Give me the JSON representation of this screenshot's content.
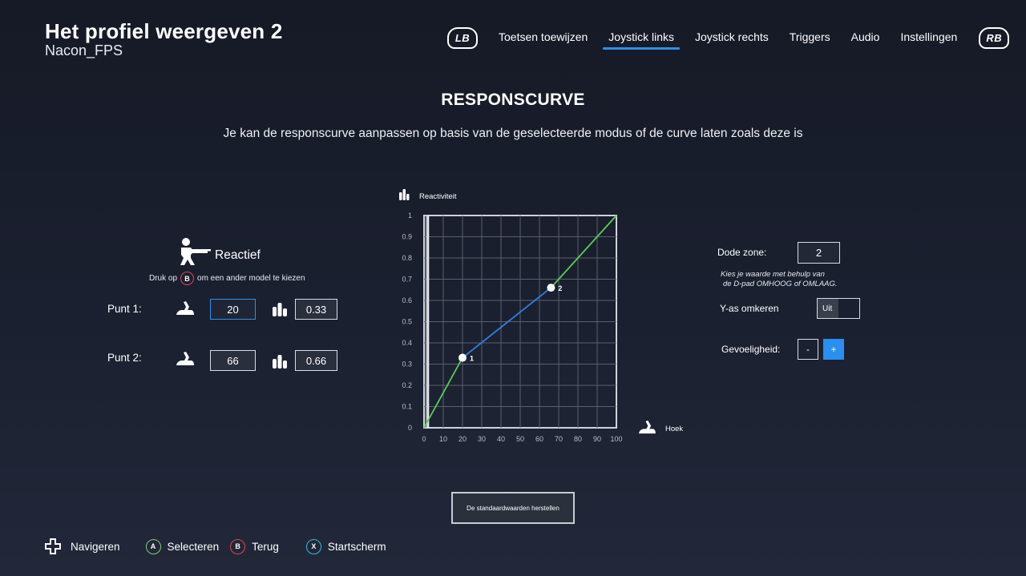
{
  "header": {
    "title": "Het profiel weergeven 2",
    "subtitle": "Nacon_FPS",
    "lb": "LB",
    "rb": "RB",
    "tabs": [
      {
        "label": "Toetsen toewijzen"
      },
      {
        "label": "Joystick links",
        "active": true
      },
      {
        "label": "Joystick rechts"
      },
      {
        "label": "Triggers"
      },
      {
        "label": "Audio"
      },
      {
        "label": "Instellingen"
      }
    ],
    "accent": "#2f8fe8"
  },
  "section": {
    "title": "RESPONSCURVE",
    "description": "Je kan de responscurve aanpassen op basis van de geselecteerde modus of de curve laten zoals deze is"
  },
  "model": {
    "icon": "shooter-icon",
    "name": "Reactief",
    "hint_prefix": "Druk op",
    "hint_button": "B",
    "hint_suffix": "om een ander model te kiezen"
  },
  "points": [
    {
      "label": "Punt 1:",
      "angle": "20",
      "reactivity": "0.33"
    },
    {
      "label": "Punt 2:",
      "angle": "66",
      "reactivity": "0.66"
    }
  ],
  "chart_data": {
    "type": "line",
    "ylabel": "Reactiviteit",
    "xlabel": "Hoek",
    "xlim": [
      0,
      100
    ],
    "ylim": [
      0,
      1
    ],
    "x_ticks": [
      0,
      10,
      20,
      30,
      40,
      50,
      60,
      70,
      80,
      90,
      100
    ],
    "y_ticks": [
      0,
      0.1,
      0.2,
      0.3,
      0.4,
      0.5,
      0.6,
      0.7,
      0.8,
      0.9,
      1
    ],
    "grid": true,
    "dead_zone": 2,
    "segments": [
      {
        "from": [
          0,
          0
        ],
        "to": [
          20,
          0.33
        ],
        "color": "#5ec85a"
      },
      {
        "from": [
          20,
          0.33
        ],
        "to": [
          66,
          0.66
        ],
        "color": "#2f7fe0"
      },
      {
        "from": [
          66,
          0.66
        ],
        "to": [
          100,
          1
        ],
        "color": "#5ec85a"
      }
    ],
    "control_points": [
      {
        "label": "1",
        "x": 20,
        "y": 0.33
      },
      {
        "label": "2",
        "x": 66,
        "y": 0.66
      }
    ]
  },
  "settings": {
    "dead_zone_label": "Dode zone:",
    "dead_zone_value": "2",
    "dead_zone_note_1": "Kies je waarde met behulp van",
    "dead_zone_note_2": "de D-pad OMHOOG of OMLAAG.",
    "invert_y_label": "Y-as omkeren",
    "invert_y_value": "Uit",
    "sensitivity_label": "Gevoeligheid:",
    "minus": "-",
    "plus": "+"
  },
  "reset_button": "De standaardwaarden herstellen",
  "footer": {
    "navigate": "Navigeren",
    "select_button": "A",
    "select": "Selecteren",
    "back_button": "B",
    "back": "Terug",
    "home_button": "X",
    "home": "Startscherm"
  }
}
